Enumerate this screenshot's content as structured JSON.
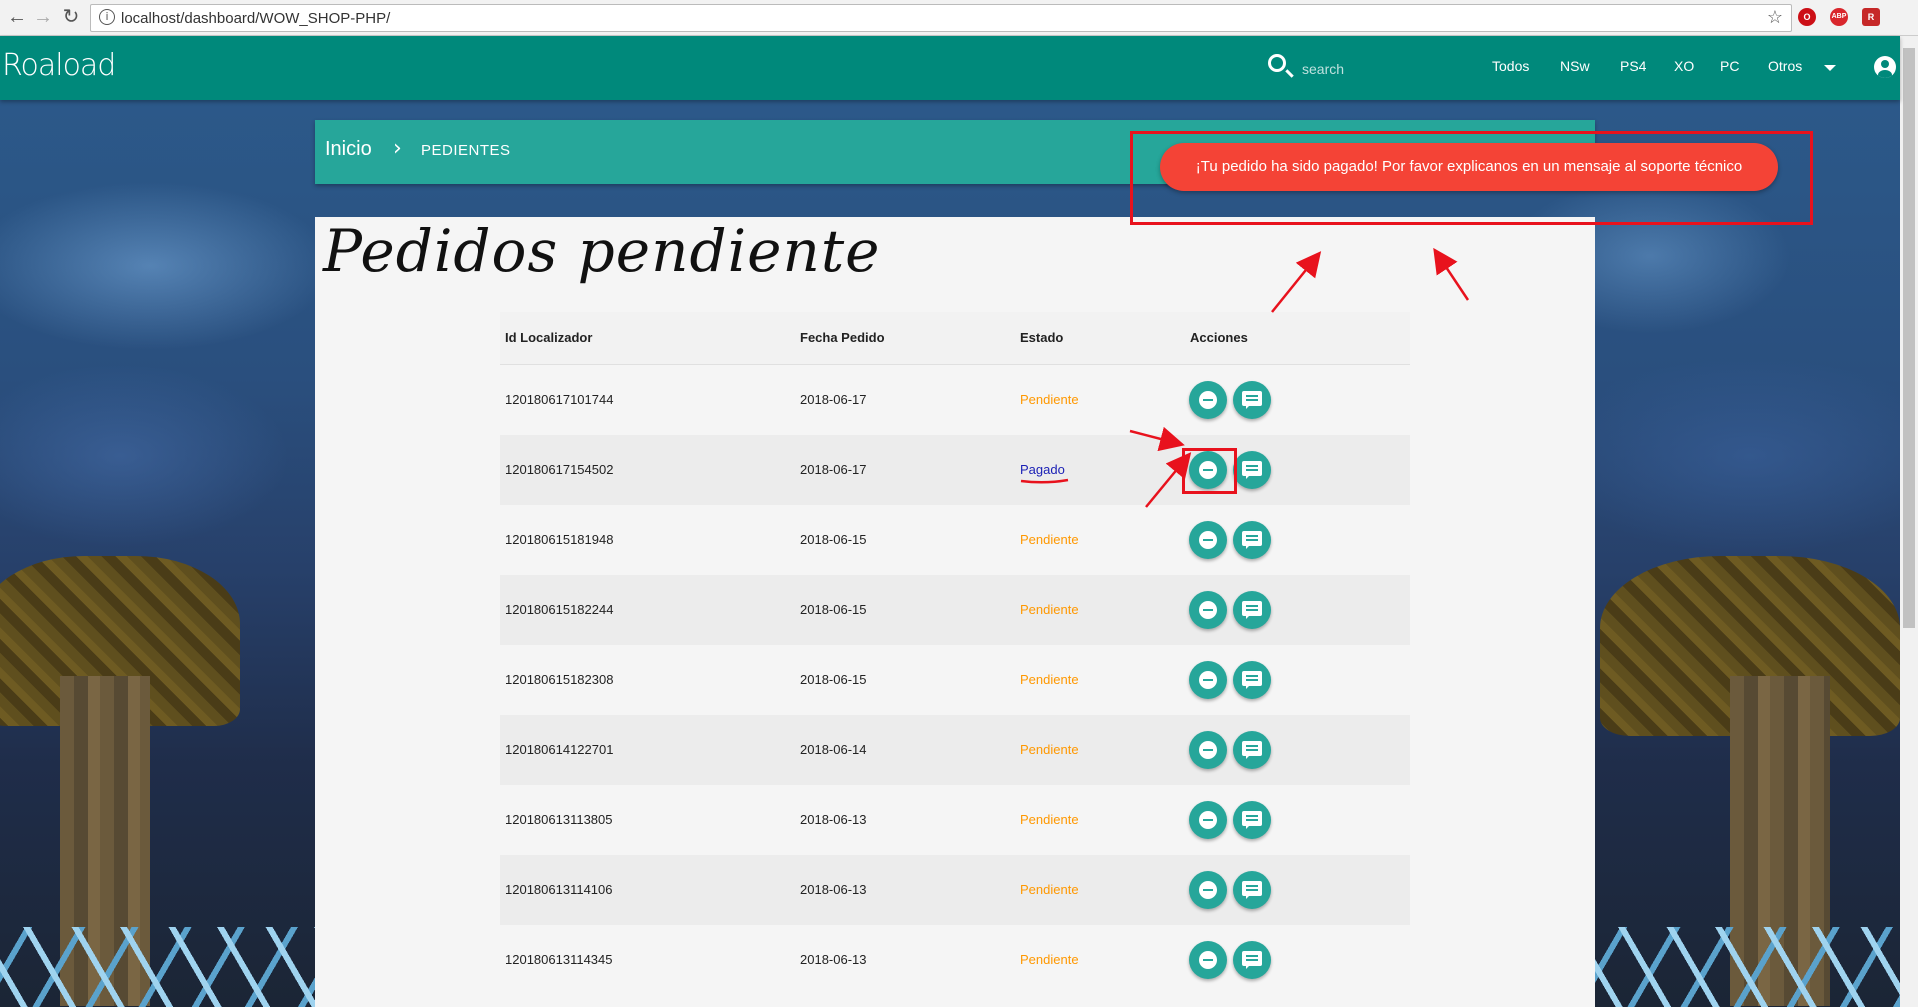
{
  "browser": {
    "url": "localhost/dashboard/WOW_SHOP-PHP/",
    "url_info": "i",
    "nav": {
      "back": "←",
      "forward": "→",
      "reload": "↻",
      "star": "☆"
    },
    "extensions": [
      "O",
      "ABP",
      "R"
    ]
  },
  "topnav": {
    "brand": "Roaload",
    "search_placeholder": "search",
    "links": [
      "Todos",
      "NSw",
      "PS4",
      "XO",
      "PC",
      "Otros"
    ]
  },
  "breadcrumb": {
    "home": "Inicio",
    "separator": "›",
    "current": "PEDIENTES"
  },
  "toast": {
    "message": "¡Tu pedido ha sido pagado! Por favor explicanos en un mensaje al soporte técnico"
  },
  "page": {
    "title": "Pedidos pendiente"
  },
  "table": {
    "columns": [
      "Id Localizador",
      "Fecha Pedido",
      "Estado",
      "Acciones"
    ],
    "rows": [
      {
        "id": "120180617101744",
        "date": "2018-06-17",
        "status": "Pendiente"
      },
      {
        "id": "120180617154502",
        "date": "2018-06-17",
        "status": "Pagado"
      },
      {
        "id": "120180615181948",
        "date": "2018-06-15",
        "status": "Pendiente"
      },
      {
        "id": "120180615182244",
        "date": "2018-06-15",
        "status": "Pendiente"
      },
      {
        "id": "120180615182308",
        "date": "2018-06-15",
        "status": "Pendiente"
      },
      {
        "id": "120180614122701",
        "date": "2018-06-14",
        "status": "Pendiente"
      },
      {
        "id": "120180613113805",
        "date": "2018-06-13",
        "status": "Pendiente"
      },
      {
        "id": "120180613114106",
        "date": "2018-06-13",
        "status": "Pendiente"
      },
      {
        "id": "120180613114345",
        "date": "2018-06-13",
        "status": "Pendiente"
      }
    ]
  },
  "colors": {
    "nav": "#00897b",
    "breadcrumb": "#26a69a",
    "toast": "#f44336",
    "pending": "#ff9800",
    "paid": "#1a1fb5",
    "annotation": "#e8121d"
  }
}
